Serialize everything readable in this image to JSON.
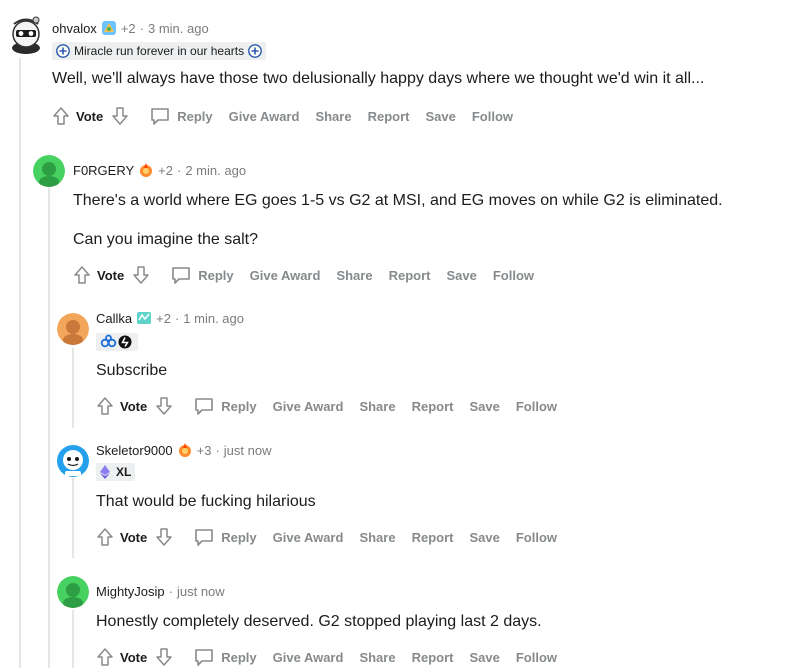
{
  "comments": [
    {
      "username": "ohvalox",
      "score": "+2",
      "time": "3 min. ago",
      "flair_text": "Miracle run forever in our hearts",
      "body": [
        "Well, we'll always have those two delusionally happy days where we thought we'd win it all..."
      ]
    },
    {
      "username": "F0RGERY",
      "score": "+2",
      "time": "2 min. ago",
      "body": [
        "There's a world where EG goes 1-5 vs G2 at MSI, and EG moves on while G2 is eliminated.",
        "Can you imagine the salt?"
      ]
    },
    {
      "username": "Callka",
      "score": "+2",
      "time": "1 min. ago",
      "body": [
        "Subscribe"
      ]
    },
    {
      "username": "Skeletor9000",
      "score": "+3",
      "time": "just now",
      "flair_text": "XL",
      "body": [
        "That would be fucking hilarious"
      ]
    },
    {
      "username": "MightyJosip",
      "time": "just now",
      "body": [
        "Honestly completely deserved. G2 stopped playing last 2 days."
      ]
    }
  ],
  "actions": {
    "vote": "Vote",
    "reply": "Reply",
    "give_award": "Give Award",
    "share": "Share",
    "report": "Report",
    "save": "Save",
    "follow": "Follow"
  },
  "dot": "·",
  "colors": {
    "thread_line": "#e6e6e6",
    "meta_gray": "#7c7c7c",
    "action_gray": "#878a8c",
    "avatar_green": "#46d160",
    "avatar_orange": "#f2a65a",
    "avatar_blue": "#24a0ed"
  }
}
